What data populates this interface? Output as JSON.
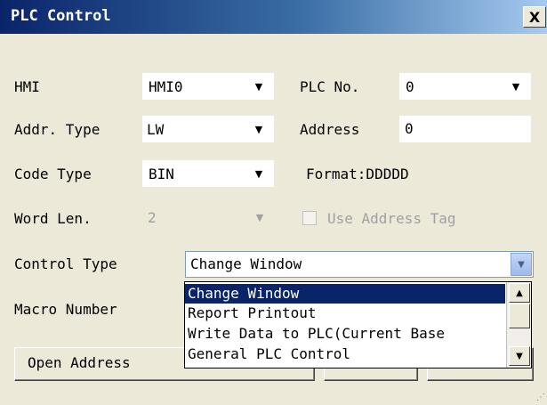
{
  "window": {
    "title": "PLC Control",
    "close_glyph": "X"
  },
  "form": {
    "hmi_label": "HMI",
    "hmi_value": "HMI0",
    "plc_no_label": "PLC No.",
    "plc_no_value": "0",
    "addr_type_label": "Addr. Type",
    "addr_type_value": "LW",
    "address_label": "Address",
    "address_value": "0",
    "code_type_label": "Code Type",
    "code_type_value": "BIN",
    "format_text": "Format:DDDDD",
    "word_len_label": "Word Len.",
    "word_len_value": "2",
    "use_address_tag_label": "Use Address Tag",
    "control_type_label": "Control Type",
    "control_type_value": "Change Window",
    "macro_number_label": "Macro Number"
  },
  "dropdown": {
    "options": [
      "Change Window",
      "Report Printout",
      "Write Data to PLC(Current Base",
      "General PLC Control"
    ],
    "selected_index": 0
  },
  "buttons": {
    "open_address_label": "Open Address"
  },
  "icons": {
    "dropdown_arrow": "chevron-down-icon",
    "scroll_up": "scroll-up-icon",
    "scroll_down": "scroll-down-icon",
    "close": "close-icon"
  },
  "colors": {
    "title_gradient_start": "#0a246a",
    "selection": "#0a246a",
    "dialog_bg": "#ece9d8"
  }
}
